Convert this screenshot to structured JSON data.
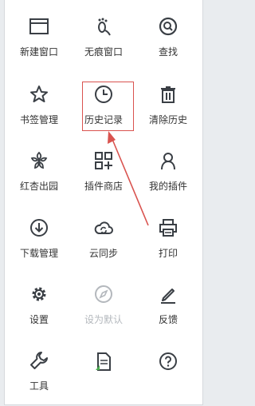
{
  "accent_color": "#3a3f45",
  "annotation_color": "#d9534f",
  "menu": {
    "items": [
      {
        "label": "新建窗口",
        "icon": "new-window-icon"
      },
      {
        "label": "无痕窗口",
        "icon": "footprint-icon"
      },
      {
        "label": "查找",
        "icon": "search-icon"
      },
      {
        "label": "书签管理",
        "icon": "star-icon"
      },
      {
        "label": "历史记录",
        "icon": "clock-icon"
      },
      {
        "label": "清除历史",
        "icon": "trash-icon"
      },
      {
        "label": "红杏出园",
        "icon": "flower-icon"
      },
      {
        "label": "插件商店",
        "icon": "grid-plus-icon"
      },
      {
        "label": "我的插件",
        "icon": "user-icon"
      },
      {
        "label": "下载管理",
        "icon": "download-icon"
      },
      {
        "label": "云同步",
        "icon": "cloud-sync-icon"
      },
      {
        "label": "打印",
        "icon": "printer-icon"
      },
      {
        "label": "设置",
        "icon": "gear-icon"
      },
      {
        "label": "设为默认",
        "icon": "compass-icon"
      },
      {
        "label": "反馈",
        "icon": "pen-icon"
      },
      {
        "label": "工具",
        "icon": "wrench-icon"
      },
      {
        "label": "",
        "icon": "document-icon"
      },
      {
        "label": "",
        "icon": "help-icon"
      }
    ]
  }
}
